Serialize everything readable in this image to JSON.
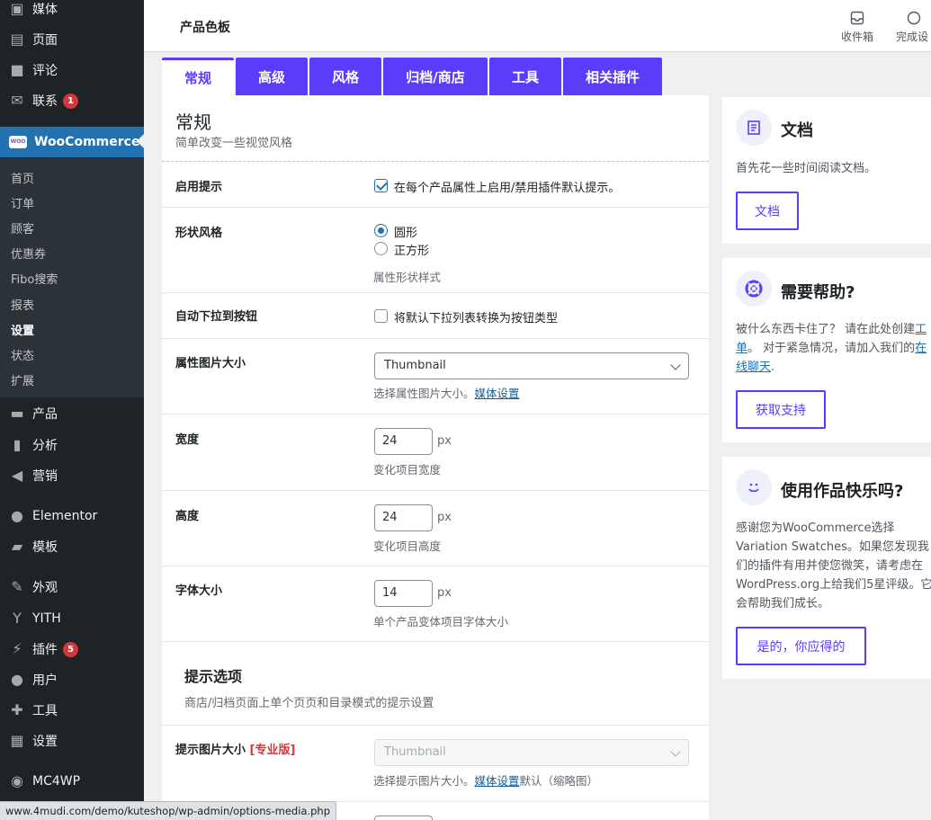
{
  "sidebar": {
    "items": [
      {
        "label": "媒体",
        "icon": "media-icon"
      },
      {
        "label": "页面",
        "icon": "page-icon"
      },
      {
        "label": "评论",
        "icon": "comment-icon"
      },
      {
        "label": "联系",
        "icon": "mail-icon",
        "badge": "1"
      },
      {
        "label": "WooCommerce",
        "icon": "woocommerce-icon"
      },
      {
        "label": "产品",
        "icon": "product-icon"
      },
      {
        "label": "分析",
        "icon": "analytics-icon"
      },
      {
        "label": "营销",
        "icon": "megaphone-icon"
      },
      {
        "label": "Elementor",
        "icon": "elementor-icon"
      },
      {
        "label": "模板",
        "icon": "folder-icon"
      },
      {
        "label": "外观",
        "icon": "brush-icon"
      },
      {
        "label": "YITH",
        "icon": "yith-icon"
      },
      {
        "label": "插件",
        "icon": "plugin-icon",
        "badge": "5"
      },
      {
        "label": "用户",
        "icon": "user-icon"
      },
      {
        "label": "工具",
        "icon": "wrench-icon"
      },
      {
        "label": "设置",
        "icon": "settings-icon"
      },
      {
        "label": "MC4WP",
        "icon": "mc4wp-icon"
      }
    ],
    "woo_logo": "WOO",
    "submenu": [
      "首页",
      "订单",
      "顾客",
      "优惠券",
      "Fibo搜索",
      "报表",
      "设置",
      "状态",
      "扩展"
    ]
  },
  "topbar": {
    "title": "产品色板",
    "inbox_label": "收件箱",
    "finish_label": "完成设"
  },
  "tabs": [
    "常规",
    "高级",
    "风格",
    "归档/商店",
    "工具",
    "相关插件"
  ],
  "general": {
    "title": "常规",
    "desc": "简单改变一些视觉风格",
    "enable_tooltip": {
      "label": "启用提示",
      "text": "在每个产品属性上启用/禁用插件默认提示。",
      "checked": true
    },
    "shape_style": {
      "label": "形状风格",
      "options": [
        "圆形",
        "正方形"
      ],
      "selected": "圆形",
      "desc": "属性形状样式"
    },
    "auto_dropdown": {
      "label": "自动下拉到按钮",
      "text": "将默认下拉列表转换为按钮类型",
      "checked": false
    },
    "attr_image_size": {
      "label": "属性图片大小",
      "value": "Thumbnail",
      "desc": "选择属性图片大小。",
      "link": "媒体设置"
    },
    "width": {
      "label": "宽度",
      "value": "24",
      "unit": "px",
      "desc": "变化项目宽度"
    },
    "height": {
      "label": "高度",
      "value": "24",
      "unit": "px",
      "desc": "变化项目高度"
    },
    "font_size": {
      "label": "字体大小",
      "value": "14",
      "unit": "px",
      "desc": "单个产品变体项目字体大小"
    }
  },
  "tooltip_section": {
    "title": "提示选项",
    "desc": "商店/归档页面上单个页页和目录模式的提示设置",
    "image_size": {
      "label": "提示图片大小",
      "pro": "[专业版]",
      "value": "Thumbnail",
      "desc": "选择提示图片大小。",
      "link": "媒体设置",
      "desc_suffix": "默认（缩略图）"
    }
  },
  "cards": {
    "docs": {
      "title": "文档",
      "text": "首先花一些时间阅读文档。",
      "button": "文档"
    },
    "help": {
      "title": "需要帮助?",
      "text_1": "被什么东西卡住了？ 请在此处创建",
      "link_1": "工单",
      "text_2": "。 对于紧急情况，请加入我们的",
      "link_2": "在线聊天",
      "text_3": ".",
      "button": "获取支持"
    },
    "happy": {
      "title": "使用作品快乐吗?",
      "text": "感谢您为WooCommerce选择Variation Swatches。如果您发现我们的插件有用并使您微笑，请考虑在WordPress.org上给我们5星评级。它会帮助我们成长。",
      "button": "是的，你应得的"
    }
  },
  "statusbar": {
    "url": "www.4mudi.com/demo/kuteshop/wp-admin/options-media.php"
  },
  "colors": {
    "accent": "#5c3cfa",
    "sidebar_bg": "#1d2327",
    "woo_active": "#2271b1",
    "badge": "#d63638"
  }
}
